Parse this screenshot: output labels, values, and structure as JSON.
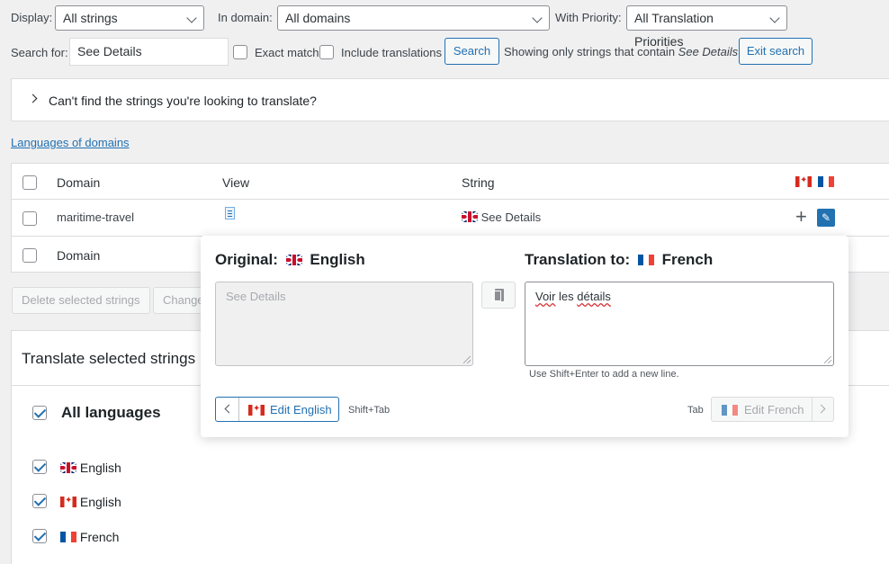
{
  "filters": {
    "display_label": "Display:",
    "display_value": "All strings",
    "domain_label": "In domain:",
    "domain_value": "All domains",
    "priority_label": "With Priority:",
    "priority_value": "All Translation Priorities",
    "search_label": "Search for:",
    "search_value": "See Details",
    "exact_match_label": "Exact match",
    "include_translations_label": "Include translations",
    "search_button": "Search",
    "showing_prefix": "Showing only strings that contain ",
    "showing_term": "See Details",
    "exit_search_button": "Exit search"
  },
  "help_box": {
    "text": "Can't find the strings you're looking to translate?"
  },
  "languages_link": "Languages of domains",
  "table": {
    "headers": {
      "domain": "Domain",
      "view": "View",
      "string": "String"
    },
    "row": {
      "domain": "maritime-travel",
      "string": "See Details"
    },
    "footer_domain": "Domain"
  },
  "bulk": {
    "delete_button": "Delete selected strings",
    "change_button": "Change"
  },
  "translate_section": {
    "title": "Translate selected strings",
    "all_languages": "All languages",
    "languages": [
      "English",
      "English",
      "French"
    ]
  },
  "popup": {
    "original_label": "Original:",
    "original_lang": "English",
    "translation_label": "Translation to:",
    "translation_lang": "French",
    "original_placeholder": "See Details",
    "translation_value_1": "Voir",
    "translation_value_2": "les",
    "translation_value_3": "détails",
    "hint": "Use Shift+Enter to add a new line.",
    "edit_english": "Edit English",
    "shift_tab": "Shift+Tab",
    "tab": "Tab",
    "edit_french": "Edit French"
  },
  "colors": {
    "accent": "#2271b1",
    "edit_icon_bg": "#2271b1"
  }
}
